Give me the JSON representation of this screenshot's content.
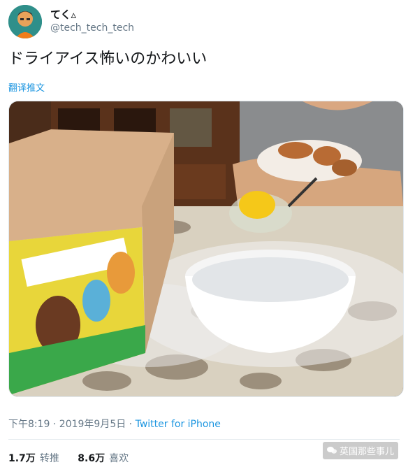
{
  "user": {
    "display_name": "てく▵",
    "handle": "@tech_tech_tech"
  },
  "tweet": {
    "text": "ドライアイス怖いのかわいい",
    "translate_label": "翻译推文"
  },
  "meta": {
    "time": "下午8:19 · 2019年9月5日 · ",
    "source": "Twitter for iPhone"
  },
  "stats": {
    "retweets_count": "1.7万",
    "retweets_label": "转推",
    "likes_count": "8.6万",
    "likes_label": "喜欢"
  },
  "watermark": {
    "text": "英国那些事儿"
  },
  "colors": {
    "link": "#1b95e0",
    "secondary_text": "#657786"
  }
}
